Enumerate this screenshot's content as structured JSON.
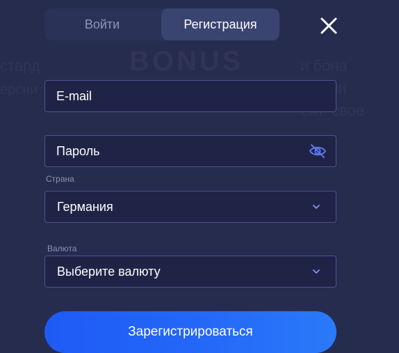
{
  "tabs": {
    "login": "Войти",
    "register": "Регистрация",
    "active": "register"
  },
  "form": {
    "email_placeholder": "E-mail",
    "password_placeholder": "Пароль",
    "country_label": "Страна",
    "country_value": "Германия",
    "currency_label": "Валюта",
    "currency_placeholder": "Выберите валюту",
    "submit_label": "Зарегистрироваться"
  },
  "colors": {
    "background": "#262c4e",
    "field_border": "#4a5590",
    "eye_icon": "#5d76e6",
    "chevron_icon": "#7f95ef",
    "submit_start": "#1f5af5",
    "submit_end": "#2a7af9"
  },
  "icons": {
    "close": "close-icon",
    "password_toggle": "eye-off-icon",
    "select_arrow": "chevron-down-icon"
  }
}
